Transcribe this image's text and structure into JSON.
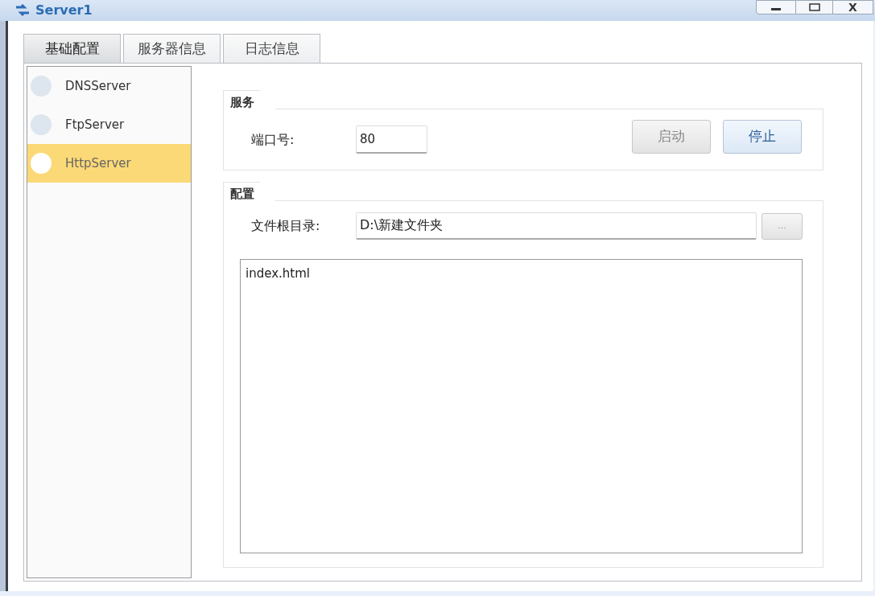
{
  "window": {
    "title": "Server1",
    "close_label": "X"
  },
  "tabs": [
    {
      "label": "基础配置",
      "selected": true
    },
    {
      "label": "服务器信息",
      "selected": false
    },
    {
      "label": "日志信息",
      "selected": false
    }
  ],
  "sidebar": {
    "items": [
      {
        "label": "DNSServer",
        "selected": false
      },
      {
        "label": "FtpServer",
        "selected": false
      },
      {
        "label": "HttpServer",
        "selected": true
      }
    ]
  },
  "service": {
    "title": "服务",
    "port_label": "端口号:",
    "port_value": "80",
    "buttons": [
      {
        "label": "启动",
        "disabled": true
      },
      {
        "label": "停止",
        "disabled": false
      }
    ]
  },
  "config": {
    "title": "配置",
    "root_label": "文件根目录:",
    "root_value": "D:\\新建文件夹",
    "browse_label": "...",
    "files": [
      "index.html"
    ]
  }
}
